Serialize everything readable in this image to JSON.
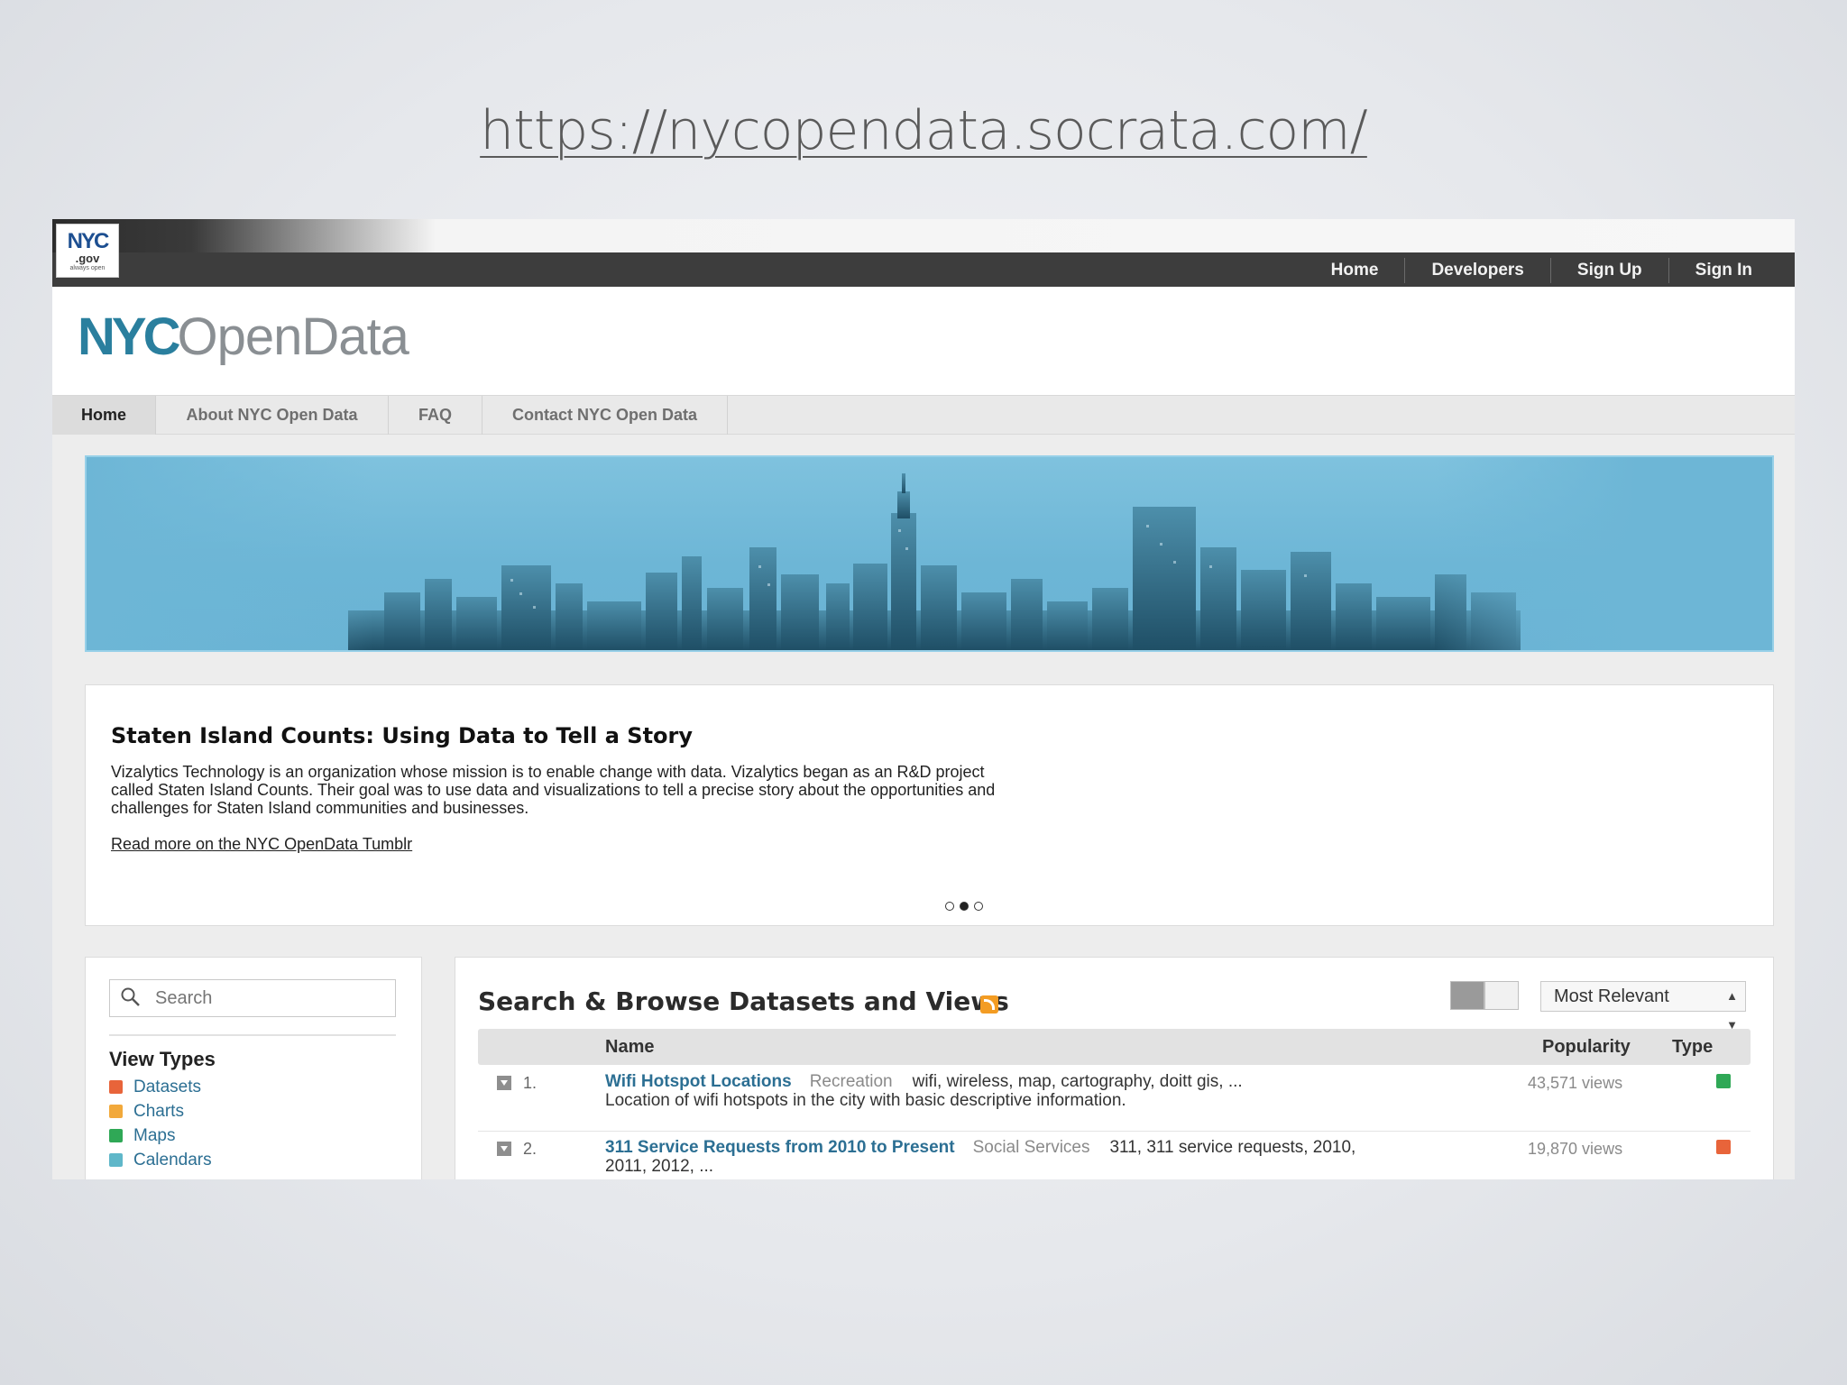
{
  "slide": {
    "url": "https://nycopendata.socrata.com/"
  },
  "header": {
    "badge": {
      "line1": "NYC",
      "line2": ".gov",
      "line3": "always open"
    },
    "nav": [
      "Home",
      "Developers",
      "Sign Up",
      "Sign In"
    ]
  },
  "brand": {
    "part1": "NYC",
    "part2": "OpenData"
  },
  "tabs": [
    "Home",
    "About NYC Open Data",
    "FAQ",
    "Contact NYC Open Data"
  ],
  "feature": {
    "title": "Staten Island Counts: Using Data to Tell a Story",
    "body": "Vizalytics Technology is an organization whose mission is to enable change with data. Vizalytics began as an R&D project called Staten Island Counts. Their goal was to use data and visualizations to tell a precise story about the opportunities and challenges for Staten Island communities and businesses.",
    "link": "Read more on the NYC OpenData Tumblr",
    "carousel_active_index": 1
  },
  "sidebar": {
    "search_placeholder": "Search",
    "view_types_heading": "View Types",
    "view_types": [
      {
        "label": "Datasets",
        "color": "#e8643a"
      },
      {
        "label": "Charts",
        "color": "#f2a93b"
      },
      {
        "label": "Maps",
        "color": "#2fa856"
      },
      {
        "label": "Calendars",
        "color": "#5fb7c9"
      }
    ]
  },
  "browse": {
    "title": "Search & Browse Datasets and Views",
    "sort_selected": "Most Relevant",
    "columns": {
      "name": "Name",
      "popularity": "Popularity",
      "type": "Type"
    },
    "rows": [
      {
        "num": "1.",
        "name": "Wifi Hotspot Locations",
        "category": "Recreation",
        "tags": "wifi, wireless, map, cartography, doitt gis, ...",
        "description": "Location of wifi hotspots in the city with basic descriptive information.",
        "views": "43,571 views",
        "type_color": "#2fa856"
      },
      {
        "num": "2.",
        "name": "311 Service Requests from 2010 to Present",
        "category": "Social Services",
        "tags": "311, 311 service requests, 2010,",
        "description": "2011, 2012, ...",
        "views": "19,870 views",
        "type_color": "#e8643a"
      }
    ]
  },
  "colors": {
    "brand_blue": "#2a7f9e",
    "link_blue": "#2c6f93",
    "hero_blue": "#6db6d6",
    "header_dark": "#3d3d3d",
    "rss_orange": "#f39c23"
  }
}
